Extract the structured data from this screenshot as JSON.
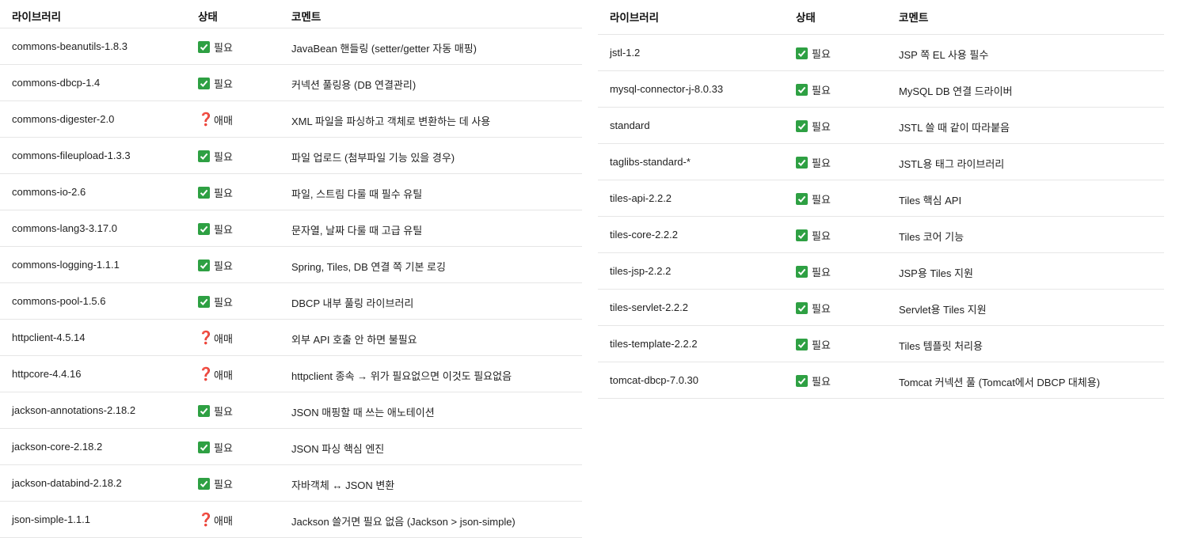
{
  "left_table": {
    "headers": [
      "라이브러리",
      "상태",
      "코멘트"
    ],
    "rows": [
      {
        "library": "commons-beanutils-1.8.3",
        "icon": "check",
        "status": "필요",
        "comment": "JavaBean 핸들링 (setter/getter 자동 매핑)"
      },
      {
        "library": "commons-dbcp-1.4",
        "icon": "check",
        "status": "필요",
        "comment": "커넥션 풀링용 (DB 연결관리)"
      },
      {
        "library": "commons-digester-2.0",
        "icon": "question",
        "status": "애매",
        "comment": "XML 파일을 파싱하고 객체로 변환하는 데 사용"
      },
      {
        "library": "commons-fileupload-1.3.3",
        "icon": "check",
        "status": "필요",
        "comment": "파일 업로드 (첨부파일 기능 있을 경우)"
      },
      {
        "library": "commons-io-2.6",
        "icon": "check",
        "status": "필요",
        "comment": "파일, 스트림 다룰 때 필수 유틸"
      },
      {
        "library": "commons-lang3-3.17.0",
        "icon": "check",
        "status": "필요",
        "comment": "문자열, 날짜 다룰 때 고급 유틸"
      },
      {
        "library": "commons-logging-1.1.1",
        "icon": "check",
        "status": "필요",
        "comment": "Spring, Tiles, DB 연결 쪽 기본 로깅"
      },
      {
        "library": "commons-pool-1.5.6",
        "icon": "check",
        "status": "필요",
        "comment": "DBCP 내부 풀링 라이브러리"
      },
      {
        "library": "httpclient-4.5.14",
        "icon": "question",
        "status": "애매",
        "comment": "외부 API 호출 안 하면 불필요"
      },
      {
        "library": "httpcore-4.4.16",
        "icon": "question",
        "status": "애매",
        "comment": "httpclient 종속 → 위가 필요없으면 이것도 필요없음"
      },
      {
        "library": "jackson-annotations-2.18.2",
        "icon": "check",
        "status": "필요",
        "comment": "JSON 매핑할 때 쓰는 애노테이션"
      },
      {
        "library": "jackson-core-2.18.2",
        "icon": "check",
        "status": "필요",
        "comment": "JSON 파싱 핵심 엔진"
      },
      {
        "library": "jackson-databind-2.18.2",
        "icon": "check",
        "status": "필요",
        "comment": "자바객체 ↔ JSON 변환"
      },
      {
        "library": "json-simple-1.1.1",
        "icon": "question",
        "status": "애매",
        "comment": "Jackson 쓸거면 필요 없음 (Jackson > json-simple)"
      }
    ]
  },
  "right_table": {
    "headers": [
      "라이브러리",
      "상태",
      "코멘트"
    ],
    "rows": [
      {
        "library": "jstl-1.2",
        "icon": "check",
        "status": "필요",
        "comment": "JSP 쪽 EL 사용 필수"
      },
      {
        "library": "mysql-connector-j-8.0.33",
        "icon": "check",
        "status": "필요",
        "comment": "MySQL DB 연결 드라이버"
      },
      {
        "library": "standard",
        "icon": "check",
        "status": "필요",
        "comment": "JSTL 쓸 때 같이 따라붙음"
      },
      {
        "library": "taglibs-standard-*",
        "icon": "check",
        "status": "필요",
        "comment": "JSTL용 태그 라이브러리"
      },
      {
        "library": "tiles-api-2.2.2",
        "icon": "check",
        "status": "필요",
        "comment": "Tiles 핵심 API"
      },
      {
        "library": "tiles-core-2.2.2",
        "icon": "check",
        "status": "필요",
        "comment": "Tiles 코어 기능"
      },
      {
        "library": "tiles-jsp-2.2.2",
        "icon": "check",
        "status": "필요",
        "comment": "JSP용 Tiles 지원"
      },
      {
        "library": "tiles-servlet-2.2.2",
        "icon": "check",
        "status": "필요",
        "comment": "Servlet용 Tiles 지원"
      },
      {
        "library": "tiles-template-2.2.2",
        "icon": "check",
        "status": "필요",
        "comment": "Tiles 템플릿 처리용"
      },
      {
        "library": "tomcat-dbcp-7.0.30",
        "icon": "check",
        "status": "필요",
        "comment": "Tomcat 커넥션 풀 (Tomcat에서 DBCP 대체용)"
      }
    ]
  },
  "colors": {
    "check_bg": "#2ea043",
    "question": "#d0211c",
    "divider": "#e6e6e6"
  }
}
